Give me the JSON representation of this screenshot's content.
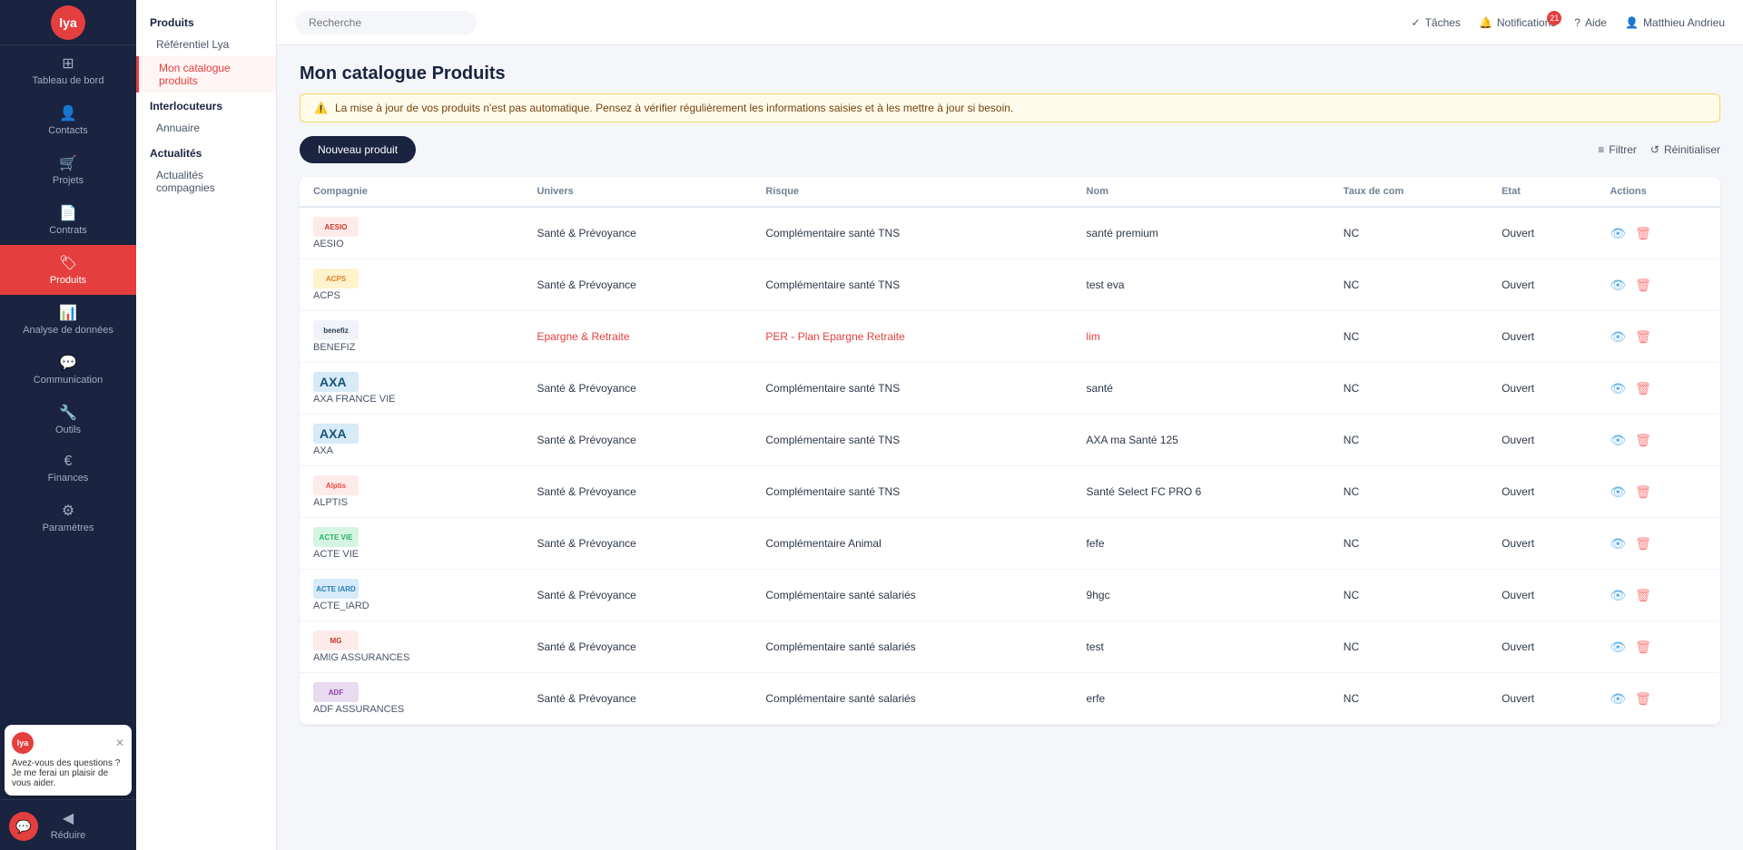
{
  "app": {
    "logo_text": "lya",
    "search_placeholder": "Recherche"
  },
  "topbar": {
    "tasks_label": "Tâches",
    "notifications_label": "Notifications",
    "notifications_count": "21",
    "help_label": "Aide",
    "user_label": "Matthieu Andrieu"
  },
  "nav": {
    "items": [
      {
        "id": "dashboard",
        "label": "Tableau de bord",
        "icon": "⊞"
      },
      {
        "id": "contacts",
        "label": "Contacts",
        "icon": "👤"
      },
      {
        "id": "projets",
        "label": "Projets",
        "icon": "🛒"
      },
      {
        "id": "contrats",
        "label": "Contrats",
        "icon": "📄"
      },
      {
        "id": "produits",
        "label": "Produits",
        "icon": "🏷"
      },
      {
        "id": "analyse",
        "label": "Analyse de données",
        "icon": "📊"
      },
      {
        "id": "communication",
        "label": "Communication",
        "icon": "💬"
      },
      {
        "id": "outils",
        "label": "Outils",
        "icon": "🔧"
      },
      {
        "id": "finances",
        "label": "Finances",
        "icon": "€"
      },
      {
        "id": "parametres",
        "label": "Paramètres",
        "icon": "⚙"
      }
    ],
    "bottom_items": [
      {
        "id": "reduire",
        "label": "Réduire",
        "icon": "◀"
      }
    ]
  },
  "sub_nav": {
    "sections": [
      {
        "title": "Produits",
        "items": [
          {
            "id": "referentiel",
            "label": "Référentiel Lya",
            "active": false
          },
          {
            "id": "mon-catalogue",
            "label": "Mon catalogue produits",
            "active": true
          }
        ]
      },
      {
        "title": "Interlocuteurs",
        "items": [
          {
            "id": "annuaire",
            "label": "Annuaire",
            "active": false
          }
        ]
      },
      {
        "title": "Actualités",
        "items": [
          {
            "id": "actualites-compagnies",
            "label": "Actualités compagnies",
            "active": false
          }
        ]
      }
    ]
  },
  "page": {
    "title": "Mon catalogue Produits",
    "alert": "La mise à jour de vos produits n'est pas automatique. Pensez à vérifier régulièrement les informations saisies et à les mettre à jour si besoin.",
    "new_product_label": "Nouveau produit",
    "filter_label": "Filtrer",
    "reset_label": "Réinitialiser"
  },
  "table": {
    "columns": [
      {
        "id": "compagnie",
        "label": "Compagnie"
      },
      {
        "id": "univers",
        "label": "Univers"
      },
      {
        "id": "risque",
        "label": "Risque"
      },
      {
        "id": "nom",
        "label": "Nom"
      },
      {
        "id": "taux_com",
        "label": "Taux de com"
      },
      {
        "id": "etat",
        "label": "Etat"
      },
      {
        "id": "actions",
        "label": "Actions"
      }
    ],
    "rows": [
      {
        "compagnie_logo": "AESIO",
        "compagnie_name": "AESIO",
        "univers": "Santé & Prévoyance",
        "risque": "Complémentaire santé TNS",
        "nom": "santé premium",
        "taux_com": "NC",
        "etat": "Ouvert",
        "logo_color": "#c0392b",
        "logo_bg": "#ffeaea"
      },
      {
        "compagnie_logo": "ACPS",
        "compagnie_name": "ACPS",
        "univers": "Santé & Prévoyance",
        "risque": "Complémentaire santé TNS",
        "nom": "test eva",
        "taux_com": "NC",
        "etat": "Ouvert",
        "logo_color": "#e67e22",
        "logo_bg": "#fff3cd"
      },
      {
        "compagnie_logo": "benefiz",
        "compagnie_name": "BENEFIZ",
        "univers": "Epargne & Retraite",
        "risque": "PER - Plan Epargne Retraite",
        "nom": "lim",
        "taux_com": "NC",
        "etat": "Ouvert",
        "logo_color": "#2c3e50",
        "logo_bg": "#f0f4f8",
        "univers_link": true,
        "risque_link": true,
        "nom_link": true
      },
      {
        "compagnie_logo": "AXA",
        "compagnie_name": "AXA FRANCE VIE",
        "univers": "Santé & Prévoyance",
        "risque": "Complémentaire santé TNS",
        "nom": "santé",
        "taux_com": "NC",
        "etat": "Ouvert",
        "logo_color": "#1a5276",
        "logo_bg": "#d6eaf8",
        "is_axa": true
      },
      {
        "compagnie_logo": "AXA",
        "compagnie_name": "AXA",
        "univers": "Santé & Prévoyance",
        "risque": "Complémentaire santé TNS",
        "nom": "AXA ma Santé 125",
        "taux_com": "NC",
        "etat": "Ouvert",
        "logo_color": "#1a5276",
        "logo_bg": "#d6eaf8",
        "is_axa": true
      },
      {
        "compagnie_logo": "Alptis",
        "compagnie_name": "ALPTIS",
        "univers": "Santé & Prévoyance",
        "risque": "Complémentaire santé TNS",
        "nom": "Santé Select FC PRO 6",
        "taux_com": "NC",
        "etat": "Ouvert",
        "logo_color": "#e74c3c",
        "logo_bg": "#ffeaea"
      },
      {
        "compagnie_logo": "ACTE VIE",
        "compagnie_name": "ACTE VIE",
        "univers": "Santé & Prévoyance",
        "risque": "Complémentaire Animal",
        "nom": "fefe",
        "taux_com": "NC",
        "etat": "Ouvert",
        "logo_color": "#27ae60",
        "logo_bg": "#d5f5e3"
      },
      {
        "compagnie_logo": "ACTE IARD",
        "compagnie_name": "ACTE_IARD",
        "univers": "Santé & Prévoyance",
        "risque": "Complémentaire santé salariés",
        "nom": "9hgc",
        "taux_com": "NC",
        "etat": "Ouvert",
        "logo_color": "#2980b9",
        "logo_bg": "#d6eaf8"
      },
      {
        "compagnie_logo": "MG",
        "compagnie_name": "AMIG ASSURANCES",
        "univers": "Santé & Prévoyance",
        "risque": "Complémentaire santé salariés",
        "nom": "test",
        "taux_com": "NC",
        "etat": "Ouvert",
        "logo_color": "#c0392b",
        "logo_bg": "#ffeaea"
      },
      {
        "compagnie_logo": "ADF",
        "compagnie_name": "ADF ASSURANCES",
        "univers": "Santé & Prévoyance",
        "risque": "Complémentaire santé salariés",
        "nom": "erfe",
        "taux_com": "NC",
        "etat": "Ouvert",
        "logo_color": "#8e44ad",
        "logo_bg": "#e8daef"
      }
    ]
  },
  "chat": {
    "bubble_text": "Avez-vous des questions ? Je me ferai un plaisir de vous aider.",
    "logo_text": "lya"
  }
}
